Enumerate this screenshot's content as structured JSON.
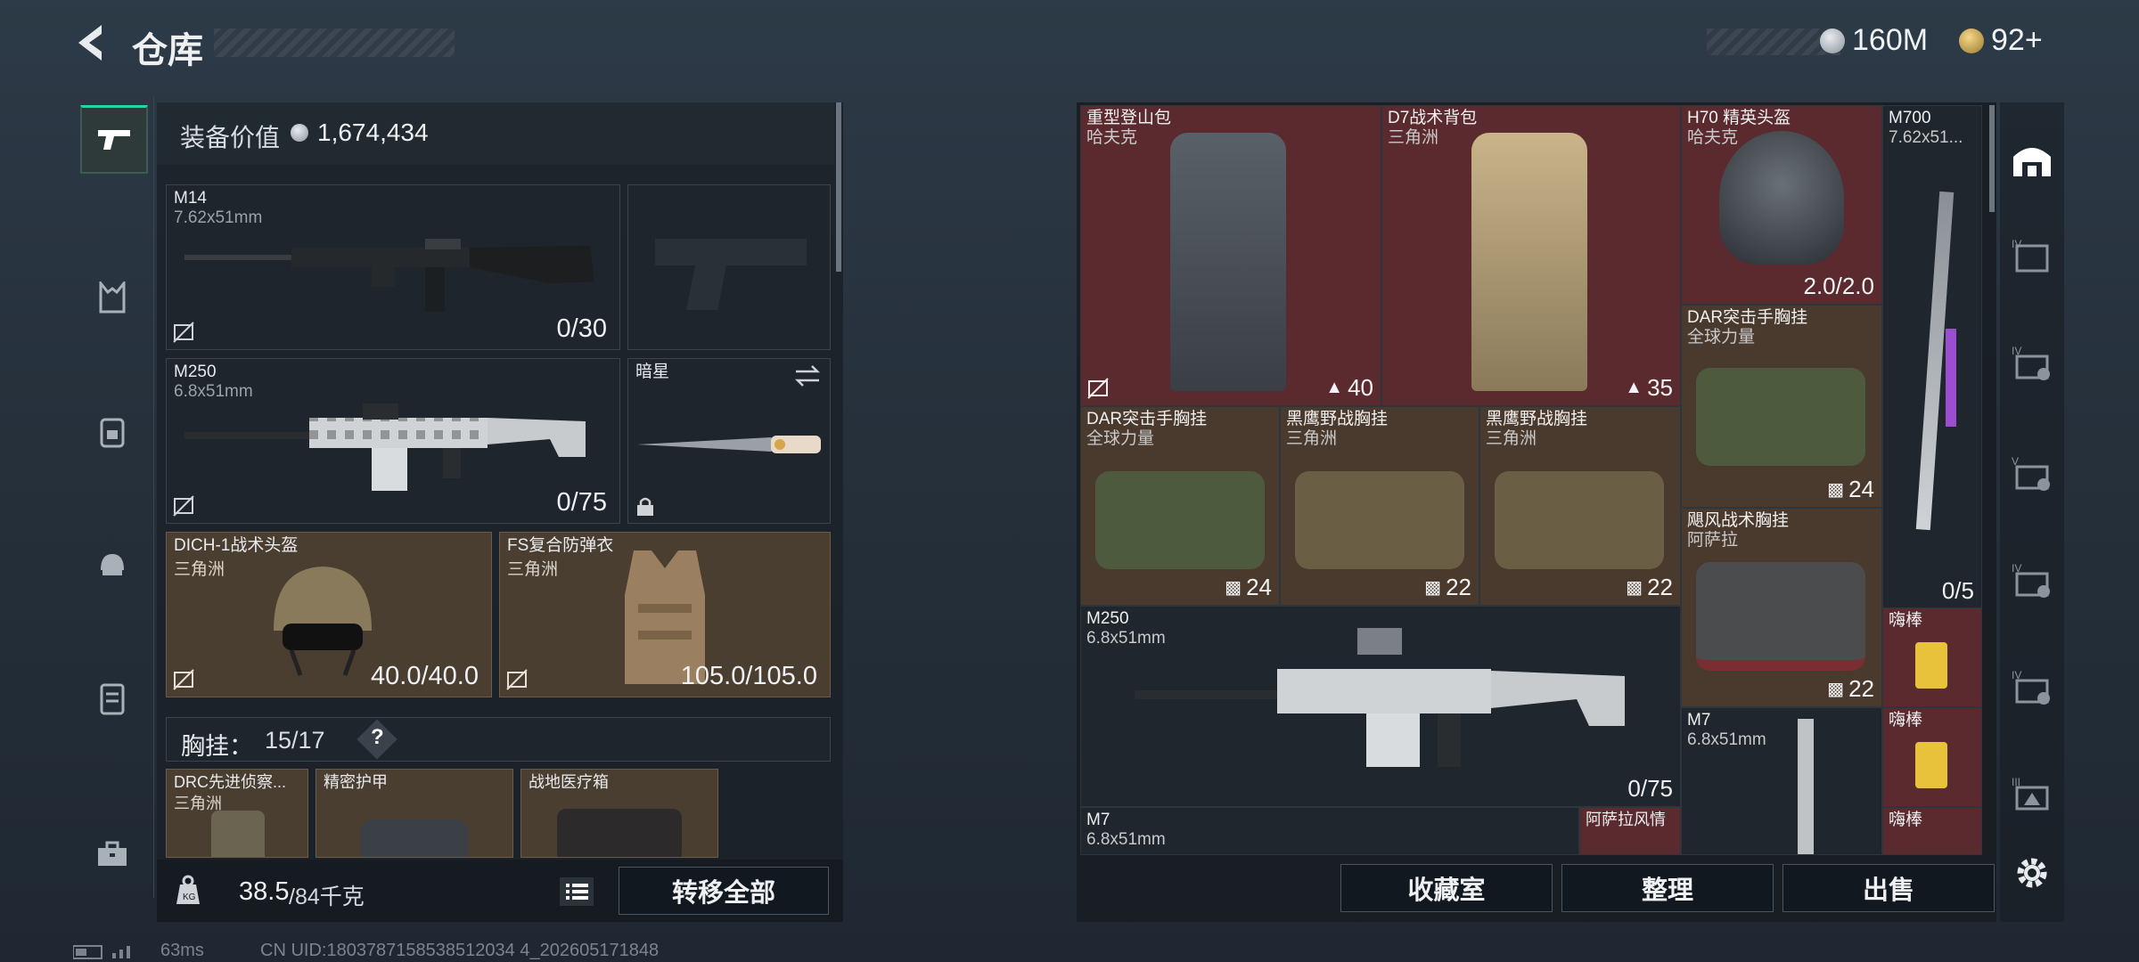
{
  "header": {
    "title": "仓库",
    "currency_1": "160M",
    "currency_2": "92+"
  },
  "left": {
    "equip_value_label": "装备价值",
    "equip_value": "1,674,434",
    "primary": {
      "name": "M14",
      "caliber": "7.62x51mm",
      "count": "0/30"
    },
    "secondary": {
      "name": "M250",
      "caliber": "6.8x51mm",
      "count": "0/75"
    },
    "melee": {
      "name": "暗星"
    },
    "helmet": {
      "name": "DICH-1战术头盔",
      "brand": "三角洲",
      "durability": "40.0/40.0"
    },
    "armor": {
      "name": "FS复合防弹衣",
      "brand": "三角洲",
      "durability": "105.0/105.0"
    },
    "rig": {
      "label": "胸挂：",
      "capacity": "15/17",
      "help": "?"
    },
    "rig_items": [
      {
        "name": "DRC先进侦察...",
        "brand": "三角洲"
      },
      {
        "name": "精密护甲"
      },
      {
        "name": "战地医疗箱"
      }
    ],
    "weight": {
      "value": "38.5",
      "max": "/84千克"
    },
    "transfer_all": "转移全部"
  },
  "status": {
    "ping": "63ms",
    "uid": "CN UID:1803787158538512034 4_202605171848"
  },
  "grid": [
    {
      "name": "重型登山包",
      "sub": "哈夫克",
      "count": "40",
      "rarity": "red"
    },
    {
      "name": "D7战术背包",
      "sub": "三角洲",
      "count": "35",
      "rarity": "red"
    },
    {
      "name": "H70 精英头盔",
      "sub": "哈夫克",
      "count": "2.0/2.0",
      "rarity": "red"
    },
    {
      "name": "M700",
      "sub": "7.62x51...",
      "count": "0/5",
      "rarity": "dark"
    },
    {
      "name": "DAR突击手胸挂",
      "sub": "全球力量",
      "count": "24",
      "rarity": "tan"
    },
    {
      "name": "DAR突击手胸挂",
      "sub": "全球力量",
      "count": "24",
      "rarity": "tan"
    },
    {
      "name": "黑鹰野战胸挂",
      "sub": "三角洲",
      "count": "22",
      "rarity": "tan"
    },
    {
      "name": "黑鹰野战胸挂",
      "sub": "三角洲",
      "count": "22",
      "rarity": "tan"
    },
    {
      "name": "飓风战术胸挂",
      "sub": "阿萨拉",
      "count": "22",
      "rarity": "tan"
    },
    {
      "name": "M250",
      "sub": "6.8x51mm",
      "count": "0/75",
      "rarity": "dark"
    },
    {
      "name": "嗨棒",
      "rarity": "red"
    },
    {
      "name": "M7",
      "sub": "6.8x51mm",
      "rarity": "dark"
    },
    {
      "name": "嗨棒",
      "rarity": "red"
    },
    {
      "name": "M7",
      "sub": "6.8x51mm",
      "rarity": "dark"
    },
    {
      "name": "阿萨拉风情",
      "rarity": "red"
    },
    {
      "name": "嗨棒",
      "rarity": "red"
    }
  ],
  "bottom_buttons": [
    "收藏室",
    "整理",
    "出售"
  ],
  "colors": {
    "accent": "#1fd6a8",
    "red_item": "#5a2a2e",
    "tan_item": "#4a3a2e"
  }
}
